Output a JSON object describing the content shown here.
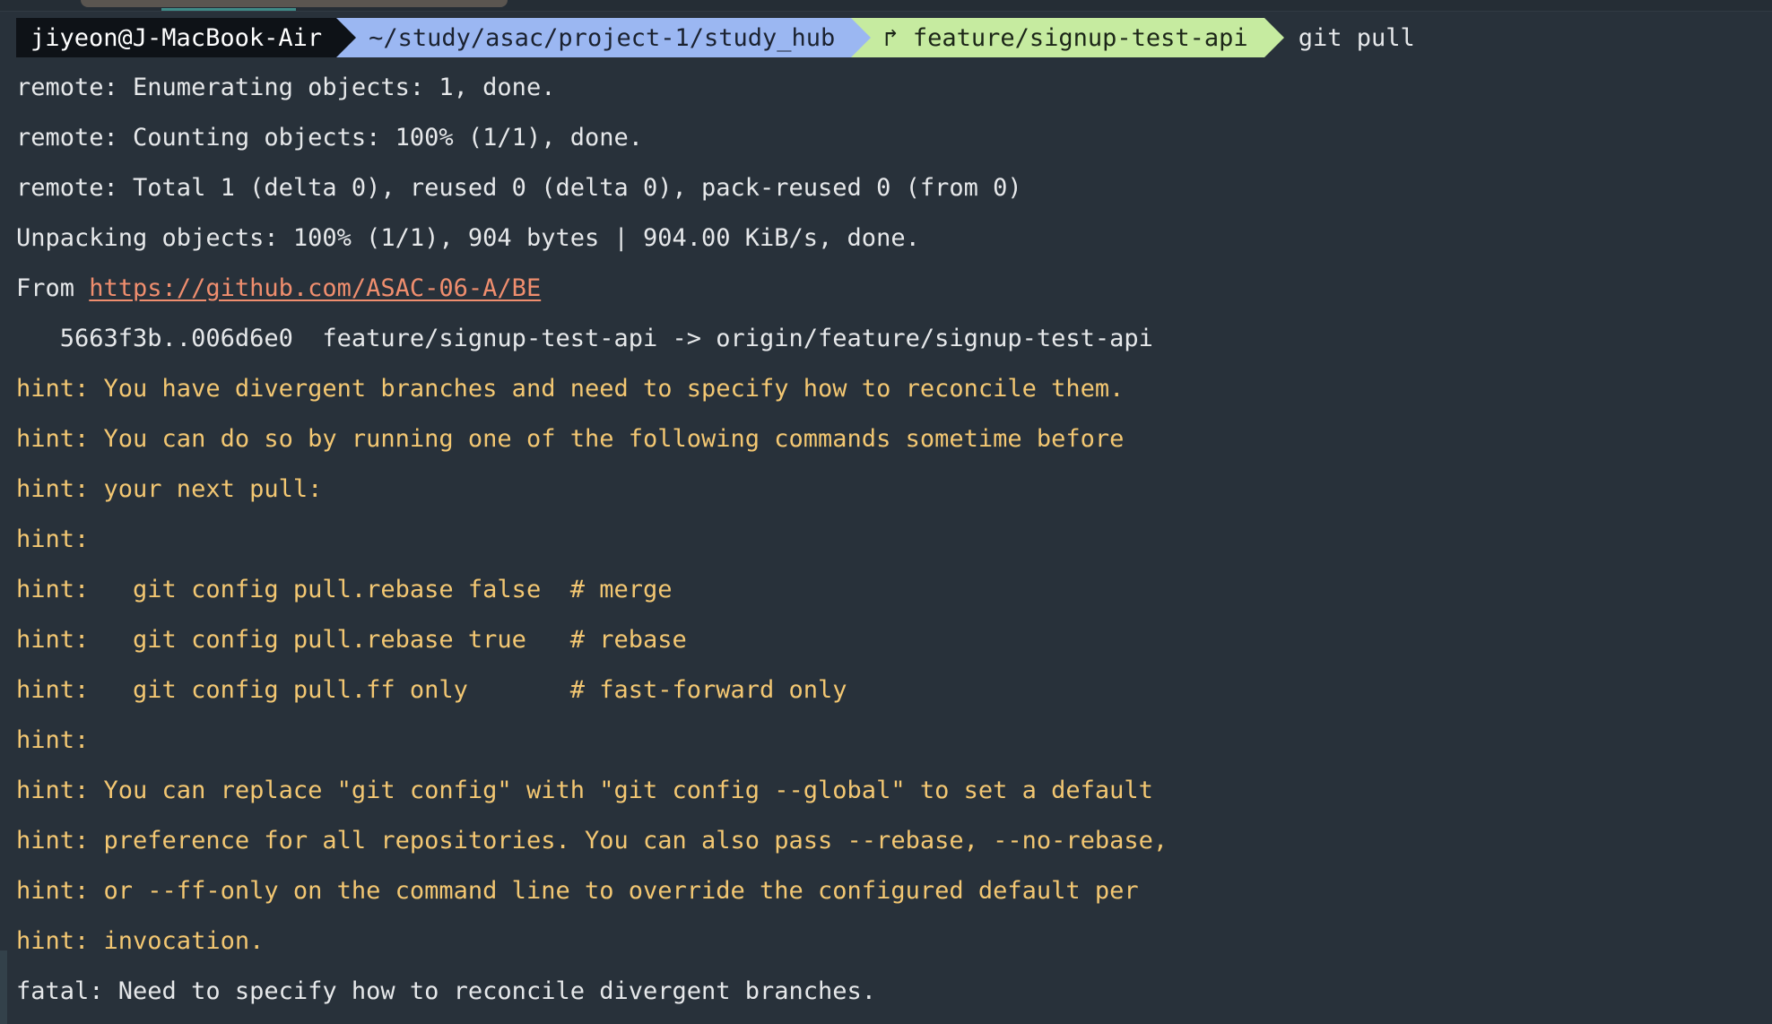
{
  "prompt": {
    "user_host": "jiyeon@J-MacBook-Air",
    "path": "~/study/asac/project-1/study_hub",
    "branch_glyph": "↱",
    "branch": "feature/signup-test-api",
    "command": "git pull"
  },
  "output": {
    "line1": "remote: Enumerating objects: 1, done.",
    "line2": "remote: Counting objects: 100% (1/1), done.",
    "line3": "remote: Total 1 (delta 0), reused 0 (delta 0), pack-reused 0 (from 0)",
    "line4": "Unpacking objects: 100% (1/1), 904 bytes | 904.00 KiB/s, done.",
    "from_label": "From ",
    "from_url": "https://github.com/ASAC-06-A/BE",
    "line6": "   5663f3b..006d6e0  feature/signup-test-api -> origin/feature/signup-test-api",
    "hint1": "hint: You have divergent branches and need to specify how to reconcile them.",
    "hint2": "hint: You can do so by running one of the following commands sometime before",
    "hint3": "hint: your next pull:",
    "hint4": "hint:",
    "hint5": "hint:   git config pull.rebase false  # merge",
    "hint6": "hint:   git config pull.rebase true   # rebase",
    "hint7": "hint:   git config pull.ff only       # fast-forward only",
    "hint8": "hint:",
    "hint9": "hint: You can replace \"git config\" with \"git config --global\" to set a default",
    "hint10": "hint: preference for all repositories. You can also pass --rebase, --no-rebase,",
    "hint11": "hint: or --ff-only on the command line to override the configured default per",
    "hint12": "hint: invocation.",
    "fatal": "fatal: Need to specify how to reconcile divergent branches."
  },
  "colors": {
    "background": "#28313a",
    "hint": "#f3c772",
    "link": "#f08e6e",
    "path_segment": "#9bb7f2",
    "branch_segment": "#c6eba0"
  }
}
